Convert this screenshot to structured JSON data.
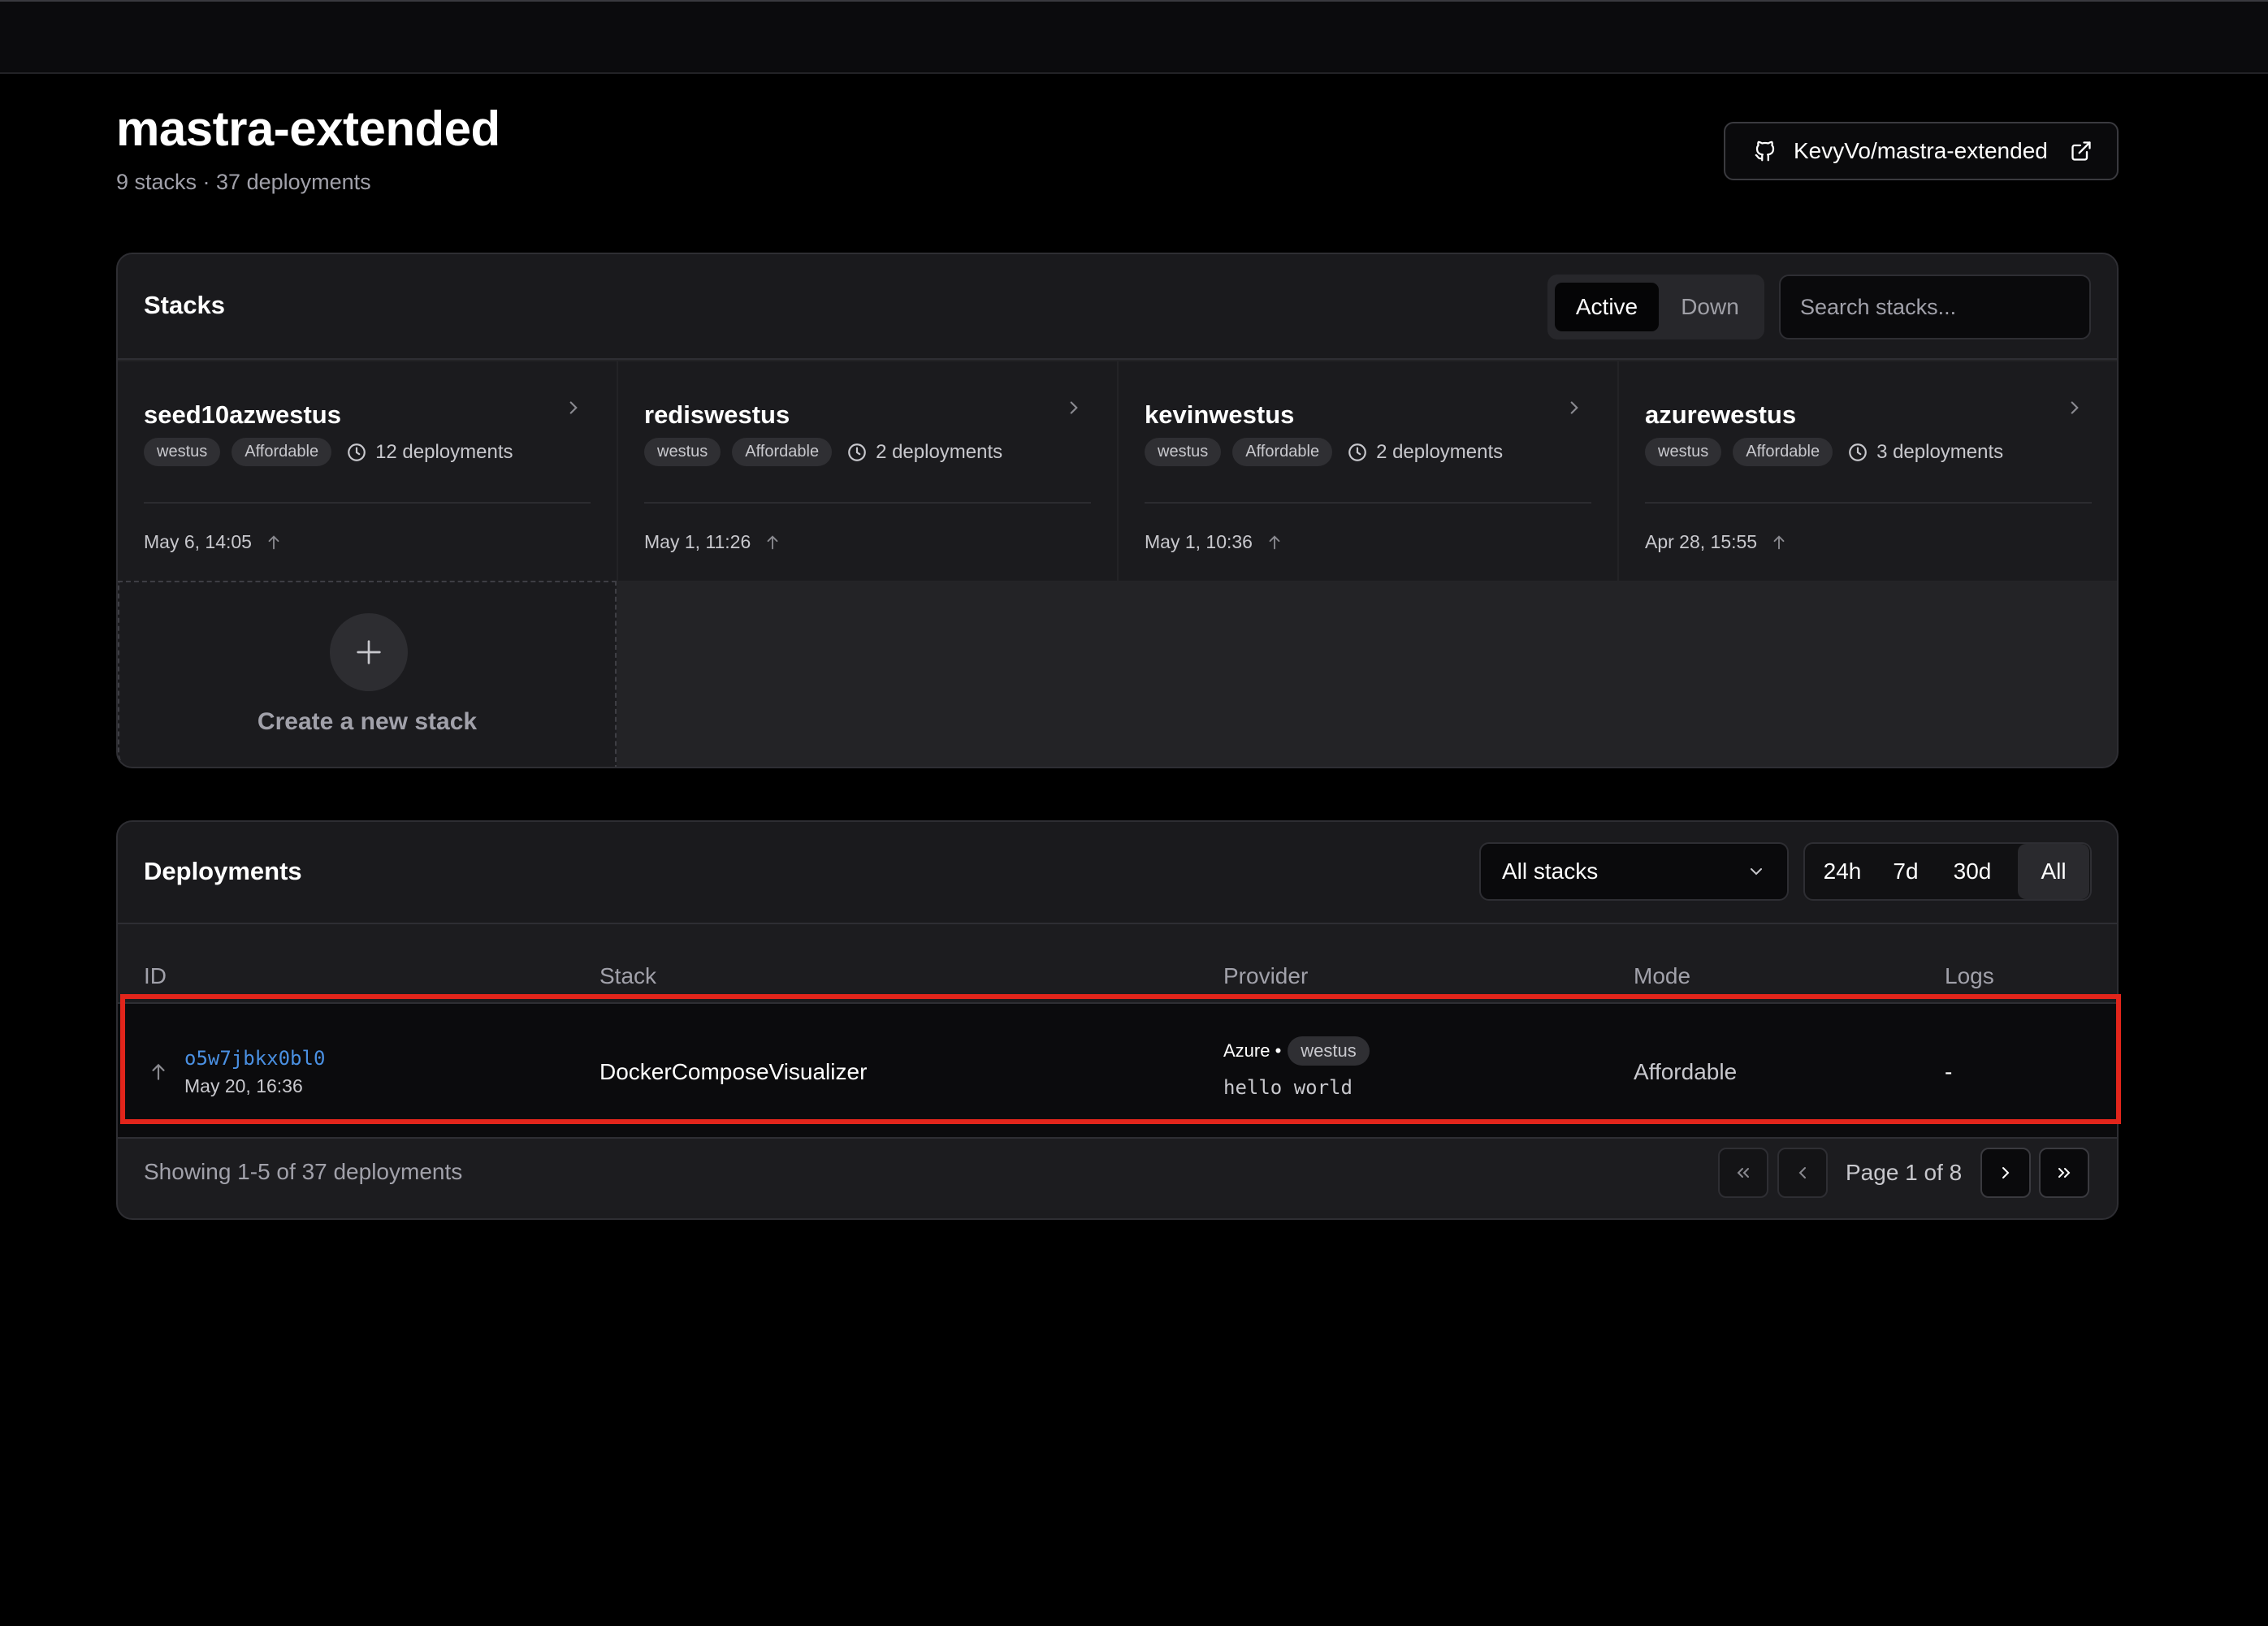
{
  "project": {
    "title": "mastra-extended",
    "summary": "9 stacks · 37 deployments",
    "repo_label": "KevyVo/mastra-extended"
  },
  "stacks_section": {
    "title": "Stacks",
    "filter_active": "Active",
    "filter_down": "Down",
    "search_placeholder": "Search stacks...",
    "create_label": "Create a new stack",
    "cards": [
      {
        "name": "seed10azwestus",
        "region": "westus",
        "tier": "Affordable",
        "deployments": "12 deployments",
        "updated": "May 6, 14:05"
      },
      {
        "name": "rediswestus",
        "region": "westus",
        "tier": "Affordable",
        "deployments": "2 deployments",
        "updated": "May 1, 11:26"
      },
      {
        "name": "kevinwestus",
        "region": "westus",
        "tier": "Affordable",
        "deployments": "2 deployments",
        "updated": "May 1, 10:36"
      },
      {
        "name": "azurewestus",
        "region": "westus",
        "tier": "Affordable",
        "deployments": "3 deployments",
        "updated": "Apr 28, 15:55"
      }
    ]
  },
  "deployments_section": {
    "title": "Deployments",
    "stack_filter": "All stacks",
    "ranges": [
      "24h",
      "7d",
      "30d",
      "All"
    ],
    "selected_range": "All",
    "columns": [
      "ID",
      "Stack",
      "Provider",
      "Mode",
      "Logs"
    ],
    "rows": [
      {
        "id": "o5w7jbkx0bl0",
        "date": "May 20, 16:36",
        "stack": "DockerComposeVisualizer",
        "provider": "Azure •",
        "region": "westus",
        "description": "hello world",
        "mode": "Affordable",
        "logs": "-"
      }
    ],
    "showing": "Showing 1-5 of 37 deployments",
    "page_label": "Page 1 of 8"
  },
  "colors": {
    "background": "#000000",
    "panel": "#1c1c1f",
    "link": "#4a90e2",
    "highlight": "#e2251b"
  },
  "icons": [
    "github-icon",
    "external-link-icon",
    "chevron-right-icon",
    "clock-icon",
    "arrow-up-icon",
    "plus-icon",
    "chevron-down-icon",
    "chevrons-left-icon",
    "chevron-left-icon",
    "chevrons-right-icon"
  ]
}
